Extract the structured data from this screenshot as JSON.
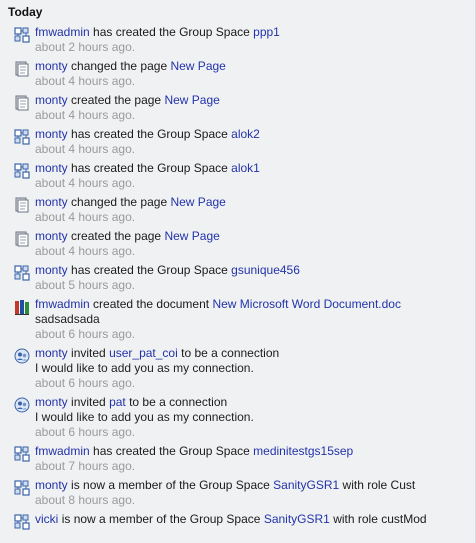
{
  "header": {
    "title": "Today"
  },
  "entries": [
    {
      "icon": "group-space-icon",
      "actor": "fmwadmin",
      "text": "has created the Group Space",
      "target": "ppp1",
      "time": "about 2 hours ago."
    },
    {
      "icon": "page-icon",
      "actor": "monty",
      "text": "changed the page",
      "target": "New Page",
      "time": "about 4 hours ago."
    },
    {
      "icon": "page-icon",
      "actor": "monty",
      "text": "created the page",
      "target": "New Page",
      "time": "about 4 hours ago."
    },
    {
      "icon": "group-space-icon",
      "actor": "monty",
      "text": "has created the Group Space",
      "target": "alok2",
      "time": "about 4 hours ago."
    },
    {
      "icon": "group-space-icon",
      "actor": "monty",
      "text": "has created the Group Space",
      "target": "alok1",
      "time": "about 4 hours ago."
    },
    {
      "icon": "page-icon",
      "actor": "monty",
      "text": "changed the page",
      "target": "New Page",
      "time": "about 4 hours ago."
    },
    {
      "icon": "page-icon",
      "actor": "monty",
      "text": "created the page",
      "target": "New Page",
      "time": "about 4 hours ago."
    },
    {
      "icon": "group-space-icon",
      "actor": "monty",
      "text": "has created the Group Space",
      "target": "gsunique456",
      "time": "about 5 hours ago."
    },
    {
      "icon": "document-icon",
      "actor": "fmwadmin",
      "text": "created the document",
      "target": "New Microsoft Word Document.doc",
      "message": "sadsadsada",
      "time": "about 6 hours ago."
    },
    {
      "icon": "connection-icon",
      "actor": "monty",
      "text": "invited",
      "target": "user_pat_coi",
      "suffix": "to be a connection",
      "message": "I would like to add you as my connection.",
      "time": "about 6 hours ago."
    },
    {
      "icon": "connection-icon",
      "actor": "monty",
      "text": "invited",
      "target": "pat",
      "suffix": "to be a connection",
      "message": "I would like to add you as my connection.",
      "time": "about 6 hours ago."
    },
    {
      "icon": "group-space-icon",
      "actor": "fmwadmin",
      "text": "has created the Group Space",
      "target": "medinitestgs15sep",
      "time": "about 7 hours ago."
    },
    {
      "icon": "group-space-icon",
      "actor": "monty",
      "text": "is now a member of the Group Space",
      "target": "SanityGSR1",
      "suffix": "with role  Cust",
      "time": "about 8 hours ago."
    },
    {
      "icon": "group-space-icon",
      "actor": "vicki",
      "text": "is now a member of the Group Space",
      "target": "SanityGSR1",
      "suffix": "with role  custMod",
      "time": ""
    }
  ]
}
